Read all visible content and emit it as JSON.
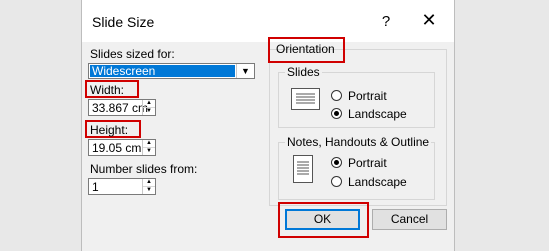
{
  "dialog": {
    "title": "Slide Size",
    "help": "?",
    "close": "✕"
  },
  "left": {
    "slides_sized_for_label": "Slides sized for:",
    "slides_sized_for_value": "Widescreen",
    "width_label": "Width:",
    "width_value": "33.867 cm",
    "height_label": "Height:",
    "height_value": "19.05 cm",
    "number_from_label": "Number slides from:",
    "number_from_value": "1"
  },
  "orientation": {
    "title": "Orientation",
    "slides": {
      "title": "Slides",
      "portrait": "Portrait",
      "landscape": "Landscape",
      "selected": "landscape"
    },
    "notes": {
      "title": "Notes, Handouts & Outline",
      "portrait": "Portrait",
      "landscape": "Landscape",
      "selected": "portrait"
    }
  },
  "buttons": {
    "ok": "OK",
    "cancel": "Cancel"
  },
  "colors": {
    "highlight": "#d00000",
    "selection": "#0078d7"
  }
}
